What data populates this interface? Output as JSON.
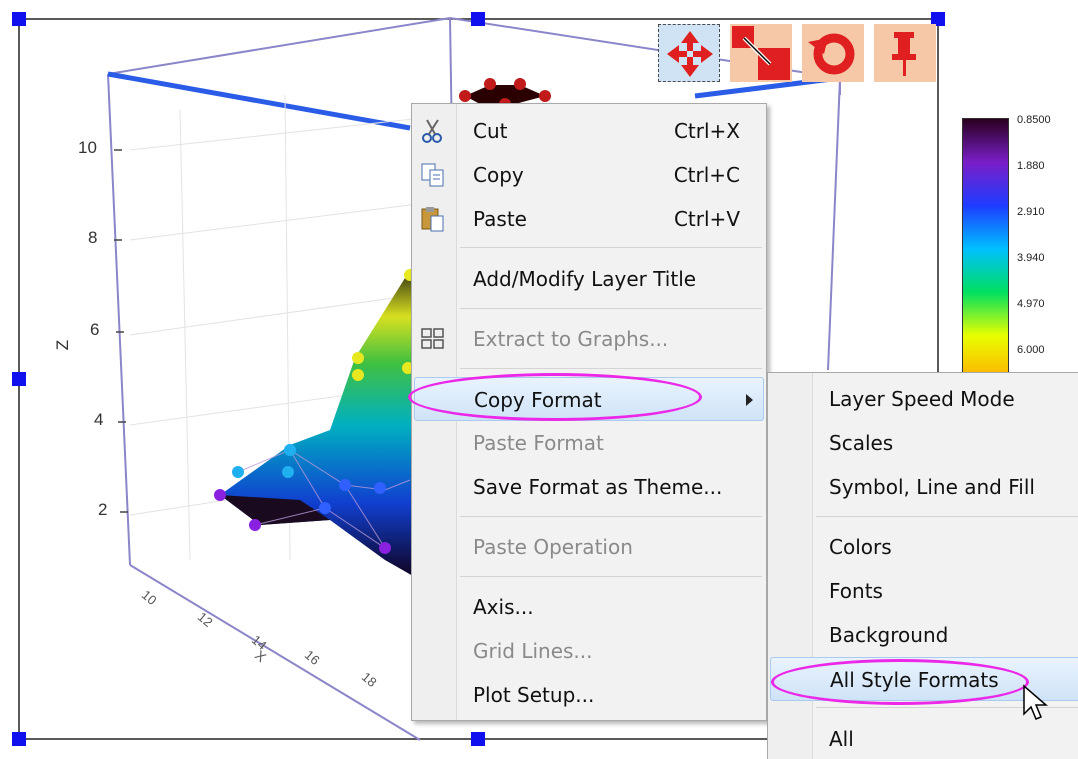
{
  "graph": {
    "z_axis_label": "Z",
    "x_axis_label": "X",
    "z_ticks": [
      "10",
      "8",
      "6",
      "4",
      "2"
    ],
    "x_ticks": [
      "10",
      "12",
      "14",
      "16",
      "18"
    ],
    "colorbar_labels": [
      "0.8500",
      "1.880",
      "2.910",
      "3.940",
      "4.970",
      "6.000"
    ],
    "colorbar_colors": [
      "#2a001e",
      "#7a1ec8",
      "#1e3cff",
      "#00c0ff",
      "#00e060",
      "#e8ff00",
      "#ffb000"
    ]
  },
  "layer_toolbar": {
    "buttons": [
      "move-layer-icon",
      "resize-layer-icon",
      "rotate-layer-icon",
      "pin-icon"
    ]
  },
  "context_menu": {
    "items": [
      {
        "label": "Cut",
        "shortcut": "Ctrl+X",
        "icon": "scissors-icon"
      },
      {
        "label": "Copy",
        "shortcut": "Ctrl+C",
        "icon": "copy-icon"
      },
      {
        "label": "Paste",
        "shortcut": "Ctrl+V",
        "icon": "paste-icon"
      },
      {
        "label": "Add/Modify Layer Title"
      },
      {
        "label": "Extract to Graphs...",
        "icon": "extract-graphs-icon",
        "disabled": true
      },
      {
        "label": "Copy Format",
        "submenu": true,
        "highlighted": true
      },
      {
        "label": "Paste Format",
        "disabled": true
      },
      {
        "label": "Save Format as Theme..."
      },
      {
        "label": "Paste Operation",
        "disabled": true
      },
      {
        "label": "Axis..."
      },
      {
        "label": "Grid Lines...",
        "disabled": true
      },
      {
        "label": "Plot Setup..."
      }
    ]
  },
  "submenu": {
    "items": [
      {
        "label": "Layer Speed Mode"
      },
      {
        "label": "Scales"
      },
      {
        "label": "Symbol, Line and Fill"
      },
      {
        "label": "Colors"
      },
      {
        "label": "Fonts"
      },
      {
        "label": "Background"
      },
      {
        "label": "All Style Formats",
        "highlighted": true
      },
      {
        "label": "All"
      }
    ]
  }
}
